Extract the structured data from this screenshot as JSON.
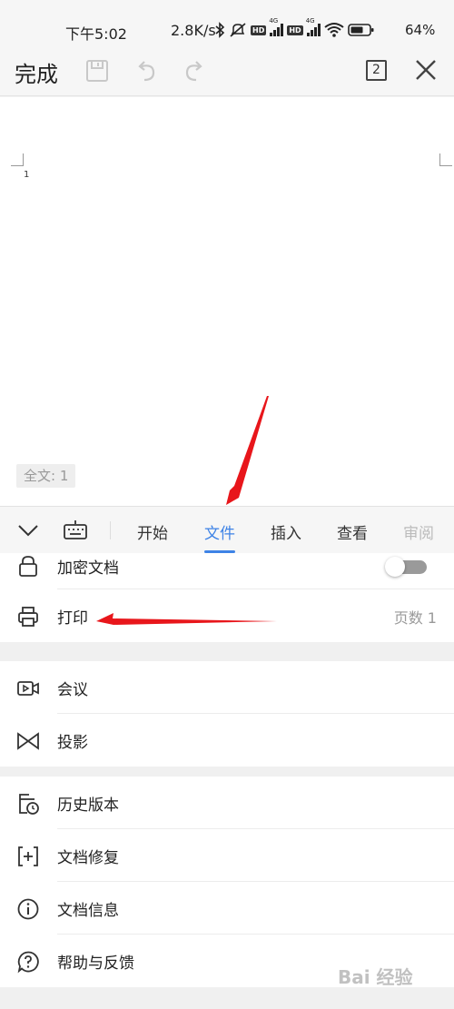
{
  "status_bar": {
    "time": "下午5:02",
    "net_speed": "2.8K/s",
    "battery": "64%",
    "icons": [
      "bluetooth-icon",
      "mute-icon",
      "signal-hd-4g-icon",
      "signal-hd-4g-icon",
      "wifi-icon",
      "battery-icon"
    ]
  },
  "toolbar": {
    "done_label": "完成",
    "page_count": "2",
    "icons": [
      "save-icon",
      "undo-icon",
      "redo-icon",
      "close-icon"
    ]
  },
  "document": {
    "line_number": "1",
    "word_count": "全文: 1"
  },
  "tabs": {
    "items": [
      {
        "label": "开始"
      },
      {
        "label": "文件"
      },
      {
        "label": "插入"
      },
      {
        "label": "查看"
      },
      {
        "label": "审阅"
      }
    ],
    "active": "文件"
  },
  "menu": {
    "encrypt": {
      "label": "加密文档",
      "enabled": false
    },
    "print": {
      "label": "打印",
      "detail": "页数 1"
    },
    "meeting": {
      "label": "会议"
    },
    "projection": {
      "label": "投影"
    },
    "history": {
      "label": "历史版本"
    },
    "repair": {
      "label": "文档修复"
    },
    "info": {
      "label": "文档信息"
    },
    "help": {
      "label": "帮助与反馈"
    }
  },
  "colors": {
    "accent": "#3e83e6",
    "annotation_arrow": "#e8161b"
  },
  "watermark": "Bai 经验"
}
